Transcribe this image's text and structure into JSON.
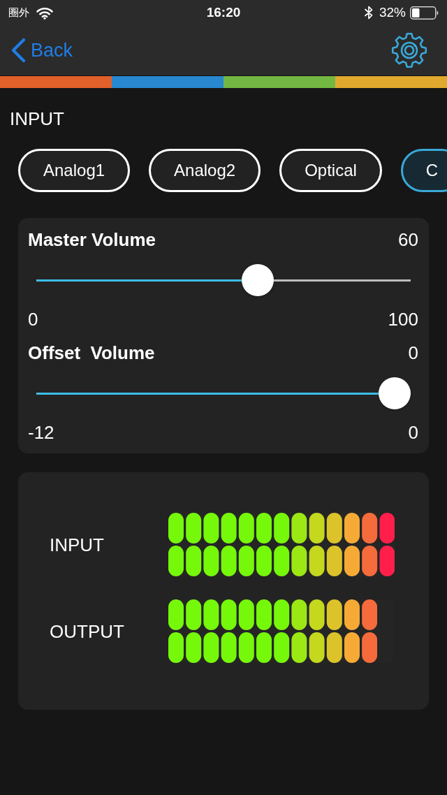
{
  "status_bar": {
    "carrier": "圈外",
    "time": "16:20",
    "battery": "32%"
  },
  "nav_bar": {
    "back": "Back"
  },
  "accent_strip": [
    {
      "color": "#e2602a"
    },
    {
      "color": "#2787cf"
    },
    {
      "color": "#73b743"
    },
    {
      "color": "#e0a92e"
    }
  ],
  "input_section": {
    "title": "INPUT",
    "sources": [
      {
        "label": "Analog1",
        "selected": false
      },
      {
        "label": "Analog2",
        "selected": false
      },
      {
        "label": "Optical",
        "selected": false
      },
      {
        "label": "C",
        "selected": true
      }
    ]
  },
  "sliders": [
    {
      "label": "Master Volume",
      "value": "60",
      "min": "0",
      "max": "100",
      "level": 0.6
    },
    {
      "label": "Offset  Volume",
      "value": "0",
      "min": "-12",
      "max": "0",
      "level": 1
    }
  ],
  "meters": [
    {
      "label": "INPUT",
      "channels": [
        {
          "level": 1
        },
        {
          "level": 1
        }
      ]
    },
    {
      "label": "OUTPUT",
      "channels": [
        {
          "level": 0.923
        },
        {
          "level": 0.923
        }
      ]
    }
  ]
}
